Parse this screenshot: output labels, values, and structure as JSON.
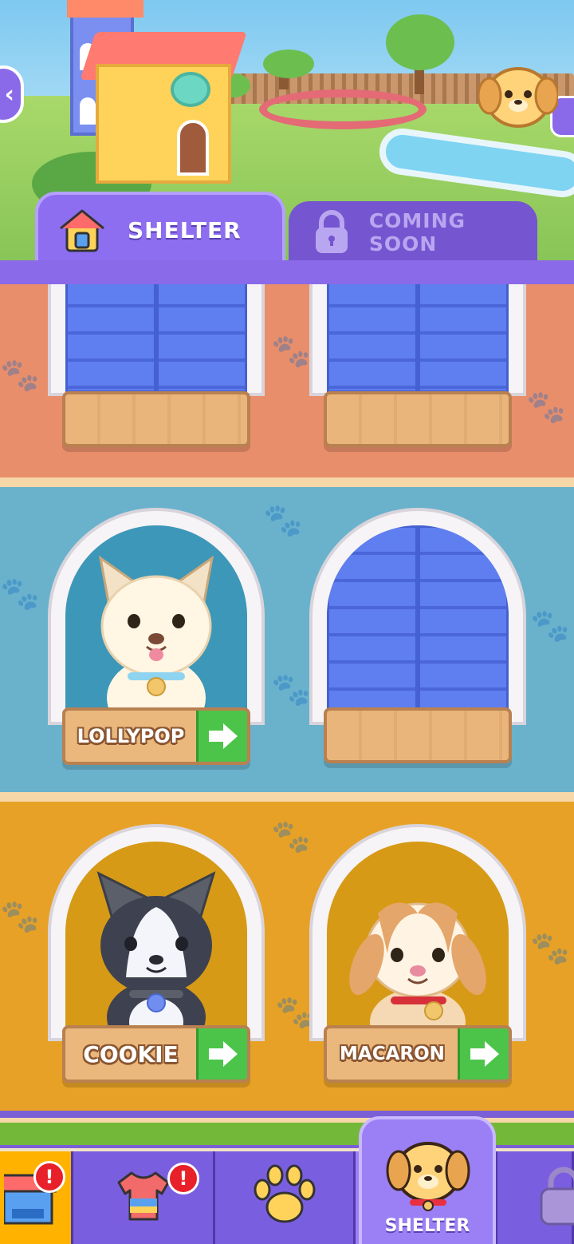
{
  "tabs": {
    "shelter_label": "SHELTER",
    "coming_soon_label": "COMING SOON"
  },
  "rooms": [
    {
      "name": "room-top",
      "windows": [
        "closed",
        "closed"
      ]
    },
    {
      "name": "room-middle",
      "windows": [
        {
          "pet": "LOLLYPOP"
        },
        "closed"
      ]
    },
    {
      "name": "room-bottom",
      "windows": [
        {
          "pet": "COOKIE"
        },
        {
          "pet": "MACARON"
        }
      ]
    }
  ],
  "pets": {
    "lollypop": "LOLLYPOP",
    "cookie": "COOKIE",
    "macaron": "MACARON"
  },
  "nav": {
    "shop_badge": "!",
    "outfit_badge": "!",
    "shelter_label": "SHELTER"
  },
  "colors": {
    "accent": "#8a6ae8",
    "room_top": "#e98e6a",
    "room_middle": "#6ab2cc",
    "room_bottom": "#e7a126",
    "go_button": "#4cc44a",
    "badge": "#e8202a"
  },
  "icons": {
    "back": "chevron-left-icon",
    "shelter_tab": "house-icon",
    "coming_soon_tab": "lock-icon",
    "go": "arrow-right-icon",
    "nav_shop": "shop-icon",
    "nav_outfit": "shirt-icon",
    "nav_paw": "paw-icon",
    "nav_shelter": "dog-face-icon",
    "nav_lock": "lock-icon"
  }
}
